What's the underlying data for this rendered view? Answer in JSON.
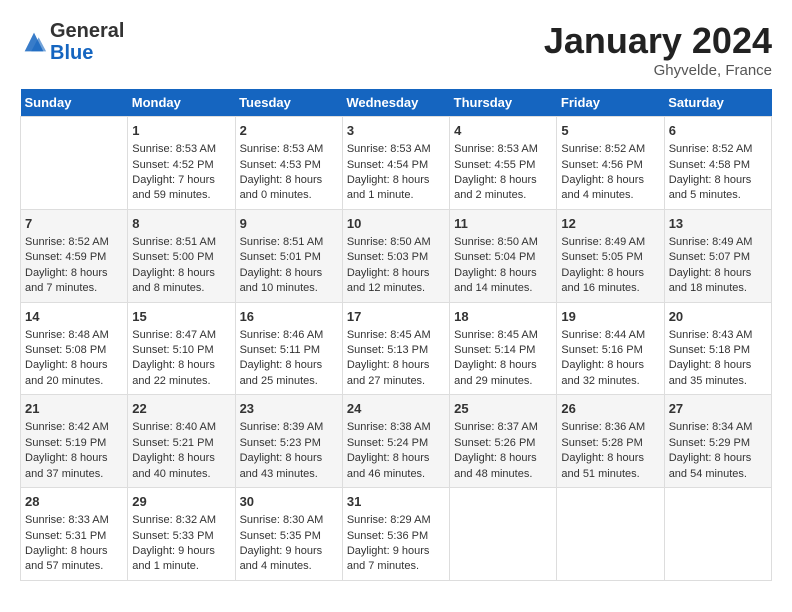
{
  "header": {
    "logo_general": "General",
    "logo_blue": "Blue",
    "month_title": "January 2024",
    "location": "Ghyvelde, France"
  },
  "calendar": {
    "days_of_week": [
      "Sunday",
      "Monday",
      "Tuesday",
      "Wednesday",
      "Thursday",
      "Friday",
      "Saturday"
    ],
    "weeks": [
      [
        {
          "day": "",
          "content": ""
        },
        {
          "day": "1",
          "content": "Sunrise: 8:53 AM\nSunset: 4:52 PM\nDaylight: 7 hours\nand 59 minutes."
        },
        {
          "day": "2",
          "content": "Sunrise: 8:53 AM\nSunset: 4:53 PM\nDaylight: 8 hours\nand 0 minutes."
        },
        {
          "day": "3",
          "content": "Sunrise: 8:53 AM\nSunset: 4:54 PM\nDaylight: 8 hours\nand 1 minute."
        },
        {
          "day": "4",
          "content": "Sunrise: 8:53 AM\nSunset: 4:55 PM\nDaylight: 8 hours\nand 2 minutes."
        },
        {
          "day": "5",
          "content": "Sunrise: 8:52 AM\nSunset: 4:56 PM\nDaylight: 8 hours\nand 4 minutes."
        },
        {
          "day": "6",
          "content": "Sunrise: 8:52 AM\nSunset: 4:58 PM\nDaylight: 8 hours\nand 5 minutes."
        }
      ],
      [
        {
          "day": "7",
          "content": "Sunrise: 8:52 AM\nSunset: 4:59 PM\nDaylight: 8 hours\nand 7 minutes."
        },
        {
          "day": "8",
          "content": "Sunrise: 8:51 AM\nSunset: 5:00 PM\nDaylight: 8 hours\nand 8 minutes."
        },
        {
          "day": "9",
          "content": "Sunrise: 8:51 AM\nSunset: 5:01 PM\nDaylight: 8 hours\nand 10 minutes."
        },
        {
          "day": "10",
          "content": "Sunrise: 8:50 AM\nSunset: 5:03 PM\nDaylight: 8 hours\nand 12 minutes."
        },
        {
          "day": "11",
          "content": "Sunrise: 8:50 AM\nSunset: 5:04 PM\nDaylight: 8 hours\nand 14 minutes."
        },
        {
          "day": "12",
          "content": "Sunrise: 8:49 AM\nSunset: 5:05 PM\nDaylight: 8 hours\nand 16 minutes."
        },
        {
          "day": "13",
          "content": "Sunrise: 8:49 AM\nSunset: 5:07 PM\nDaylight: 8 hours\nand 18 minutes."
        }
      ],
      [
        {
          "day": "14",
          "content": "Sunrise: 8:48 AM\nSunset: 5:08 PM\nDaylight: 8 hours\nand 20 minutes."
        },
        {
          "day": "15",
          "content": "Sunrise: 8:47 AM\nSunset: 5:10 PM\nDaylight: 8 hours\nand 22 minutes."
        },
        {
          "day": "16",
          "content": "Sunrise: 8:46 AM\nSunset: 5:11 PM\nDaylight: 8 hours\nand 25 minutes."
        },
        {
          "day": "17",
          "content": "Sunrise: 8:45 AM\nSunset: 5:13 PM\nDaylight: 8 hours\nand 27 minutes."
        },
        {
          "day": "18",
          "content": "Sunrise: 8:45 AM\nSunset: 5:14 PM\nDaylight: 8 hours\nand 29 minutes."
        },
        {
          "day": "19",
          "content": "Sunrise: 8:44 AM\nSunset: 5:16 PM\nDaylight: 8 hours\nand 32 minutes."
        },
        {
          "day": "20",
          "content": "Sunrise: 8:43 AM\nSunset: 5:18 PM\nDaylight: 8 hours\nand 35 minutes."
        }
      ],
      [
        {
          "day": "21",
          "content": "Sunrise: 8:42 AM\nSunset: 5:19 PM\nDaylight: 8 hours\nand 37 minutes."
        },
        {
          "day": "22",
          "content": "Sunrise: 8:40 AM\nSunset: 5:21 PM\nDaylight: 8 hours\nand 40 minutes."
        },
        {
          "day": "23",
          "content": "Sunrise: 8:39 AM\nSunset: 5:23 PM\nDaylight: 8 hours\nand 43 minutes."
        },
        {
          "day": "24",
          "content": "Sunrise: 8:38 AM\nSunset: 5:24 PM\nDaylight: 8 hours\nand 46 minutes."
        },
        {
          "day": "25",
          "content": "Sunrise: 8:37 AM\nSunset: 5:26 PM\nDaylight: 8 hours\nand 48 minutes."
        },
        {
          "day": "26",
          "content": "Sunrise: 8:36 AM\nSunset: 5:28 PM\nDaylight: 8 hours\nand 51 minutes."
        },
        {
          "day": "27",
          "content": "Sunrise: 8:34 AM\nSunset: 5:29 PM\nDaylight: 8 hours\nand 54 minutes."
        }
      ],
      [
        {
          "day": "28",
          "content": "Sunrise: 8:33 AM\nSunset: 5:31 PM\nDaylight: 8 hours\nand 57 minutes."
        },
        {
          "day": "29",
          "content": "Sunrise: 8:32 AM\nSunset: 5:33 PM\nDaylight: 9 hours\nand 1 minute."
        },
        {
          "day": "30",
          "content": "Sunrise: 8:30 AM\nSunset: 5:35 PM\nDaylight: 9 hours\nand 4 minutes."
        },
        {
          "day": "31",
          "content": "Sunrise: 8:29 AM\nSunset: 5:36 PM\nDaylight: 9 hours\nand 7 minutes."
        },
        {
          "day": "",
          "content": ""
        },
        {
          "day": "",
          "content": ""
        },
        {
          "day": "",
          "content": ""
        }
      ]
    ]
  }
}
